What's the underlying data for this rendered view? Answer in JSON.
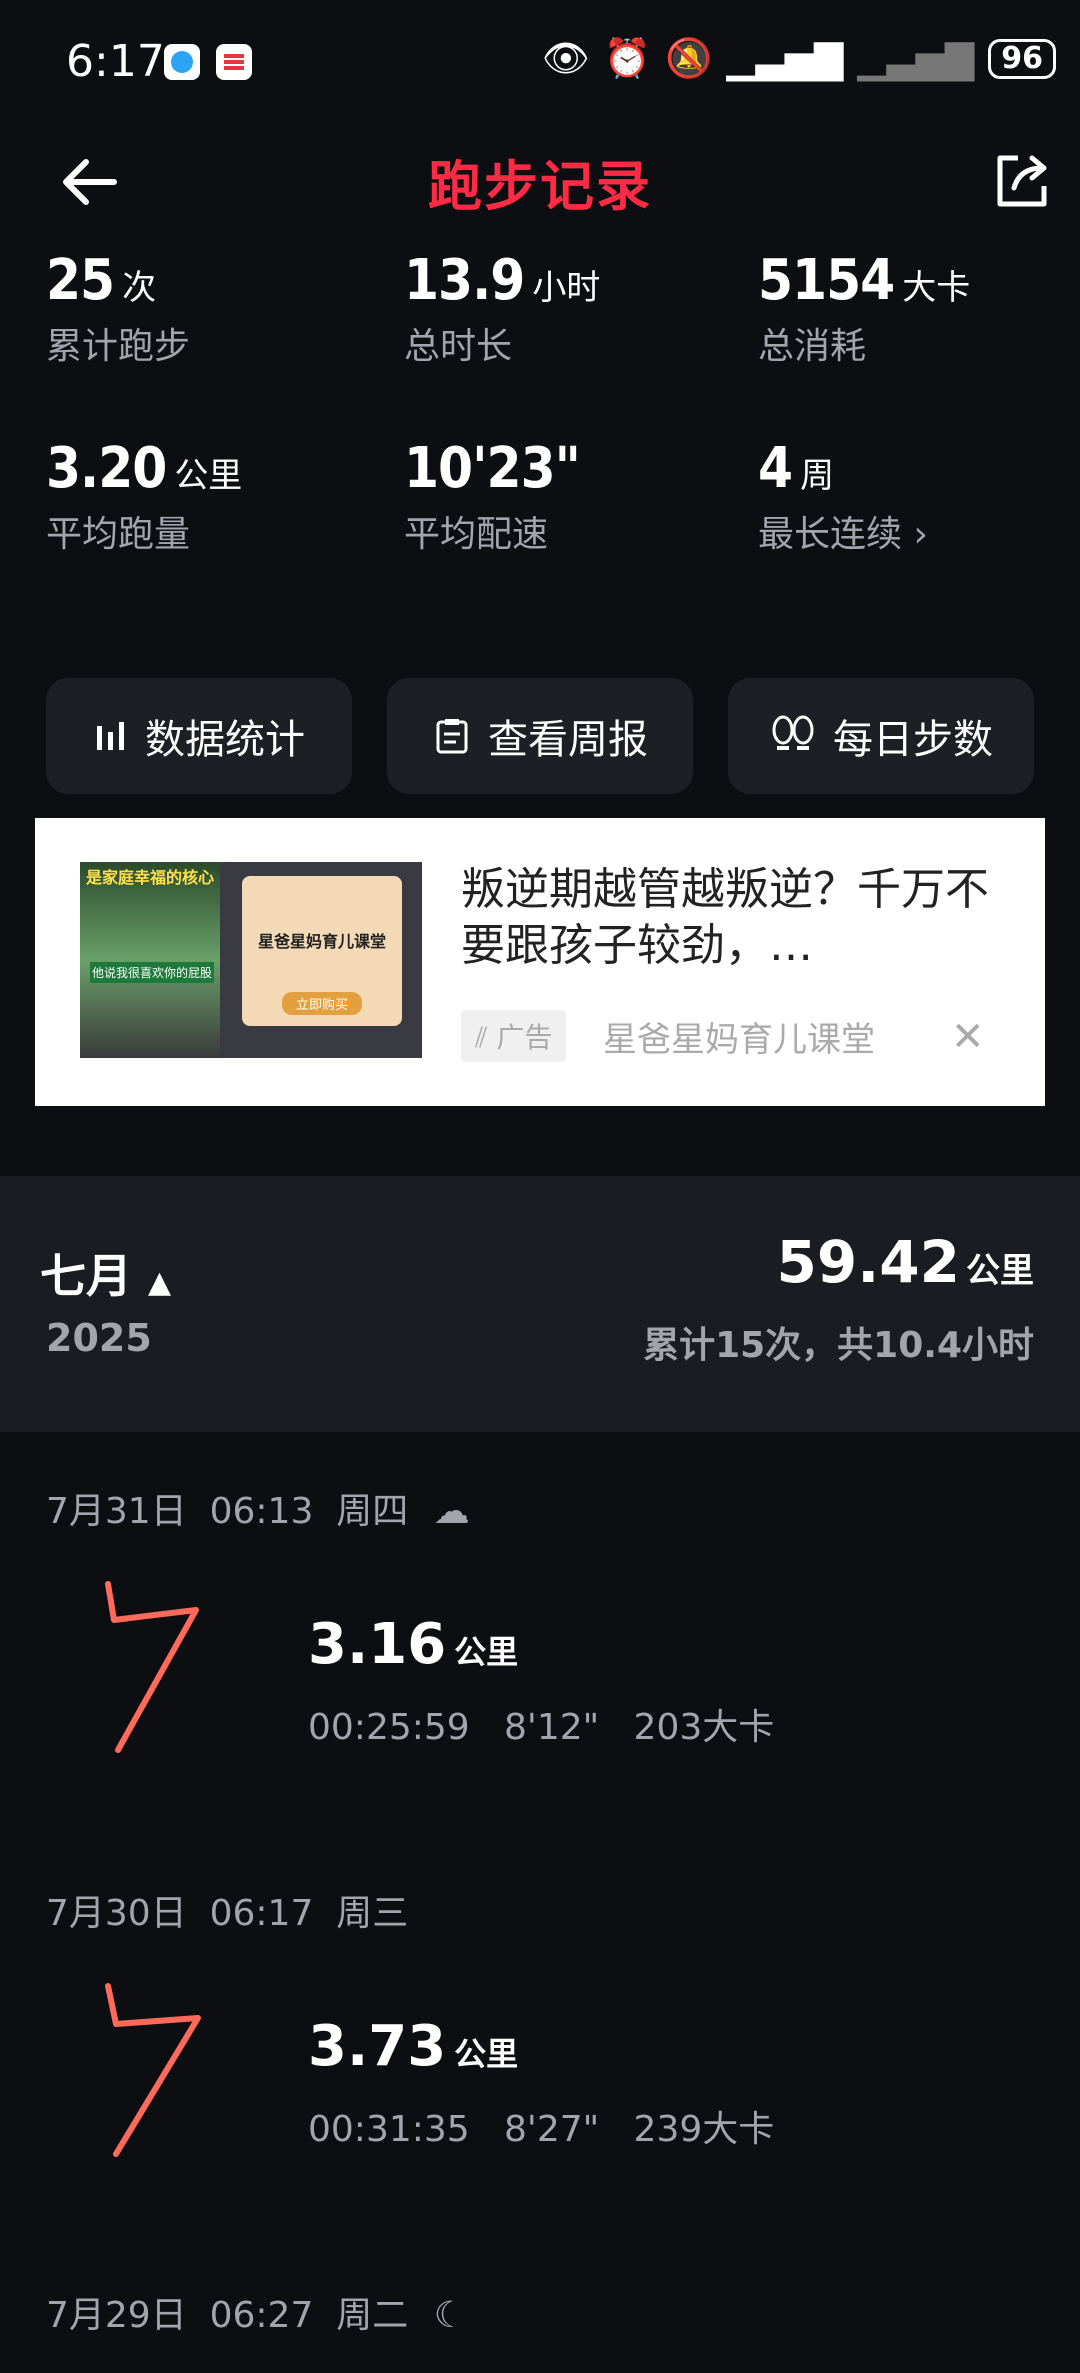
{
  "status": {
    "time": "6:17",
    "battery": "96"
  },
  "header": {
    "title": "跑步记录"
  },
  "stats": [
    {
      "value": "25",
      "unit": "次",
      "label": "累计跑步"
    },
    {
      "value": "13.9",
      "unit": "小时",
      "label": "总时长"
    },
    {
      "value": "5154",
      "unit": "大卡",
      "label": "总消耗"
    },
    {
      "value": "3.20",
      "unit": "公里",
      "label": "平均跑量"
    },
    {
      "value": "10'23\"",
      "unit": "",
      "label": "平均配速"
    },
    {
      "value": "4",
      "unit": "周",
      "label": "最长连续"
    }
  ],
  "buttons": [
    {
      "label": "数据统计",
      "icon": "bar-chart-icon"
    },
    {
      "label": "查看周报",
      "icon": "clipboard-icon"
    },
    {
      "label": "每日步数",
      "icon": "footprints-icon"
    }
  ],
  "ad": {
    "image_text_top": "是家庭幸福的核心",
    "image_caption": "他说我很喜欢你的屁股",
    "card_title": "星爸星妈育儿课堂",
    "card_button": "立即购买",
    "title": "叛逆期越管越叛逆？千万不要跟孩子较劲，…",
    "tag": "广告",
    "source": "星爸星妈育儿课堂"
  },
  "month_summary": {
    "month": "七月",
    "year": "2025",
    "distance": "59.42",
    "distance_unit": "公里",
    "summary": "累计15次，共10.4小时"
  },
  "runs": [
    {
      "date": "7月31日",
      "time": "06:13",
      "weekday": "周四",
      "weather_icon": "cloud-rain-icon",
      "distance": "3.16",
      "unit": "公里",
      "duration": "00:25:59",
      "pace": "8'12\"",
      "calories": "203大卡"
    },
    {
      "date": "7月30日",
      "time": "06:17",
      "weekday": "周三",
      "weather_icon": "",
      "distance": "3.73",
      "unit": "公里",
      "duration": "00:31:35",
      "pace": "8'27\"",
      "calories": "239大卡"
    },
    {
      "date": "7月29日",
      "time": "06:27",
      "weekday": "周二",
      "weather_icon": "moon-icon"
    }
  ],
  "colors": {
    "accent": "#ff2b44",
    "route": "#ff6a5a",
    "background": "#0d0e12",
    "panel": "#1b1c21"
  }
}
